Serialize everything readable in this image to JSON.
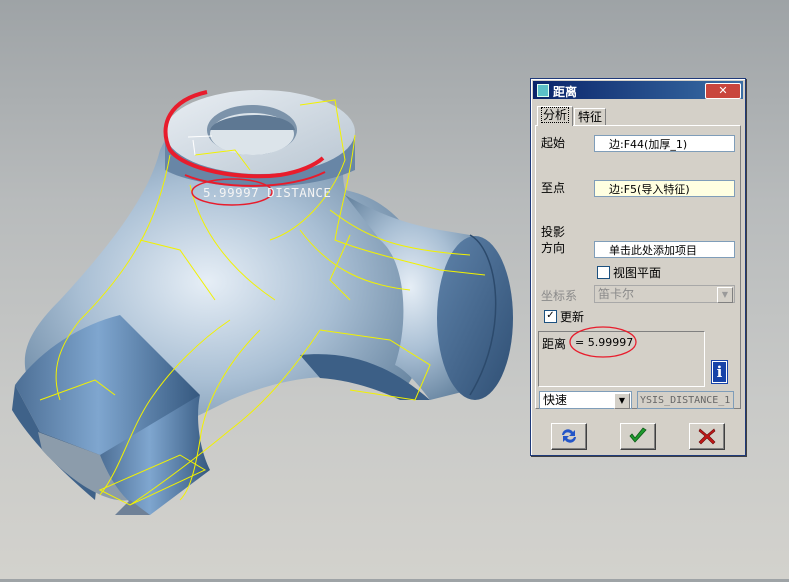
{
  "viewport": {
    "measurement_label": "5.99997 DISTANCE"
  },
  "dialog": {
    "title": "距离",
    "close_label": "✕",
    "tabs": [
      {
        "label": "分析",
        "active": true
      },
      {
        "label": "特征",
        "active": false
      }
    ],
    "from": {
      "label": "起始",
      "value": "边:F44(加厚_1)"
    },
    "to": {
      "label": "至点",
      "value": "边:F5(导入特征)"
    },
    "projection": {
      "label_line1": "投影",
      "label_line2": "方向",
      "value": "单击此处添加项目"
    },
    "view_plane": {
      "label": "视图平面",
      "checked": false
    },
    "coord_system": {
      "label": "坐标系",
      "value": "笛卡尔",
      "disabled": true
    },
    "update": {
      "label": "更新",
      "checked": true
    },
    "result": {
      "label": "距离",
      "value": "= 5.99997"
    },
    "mode_select": {
      "value": "快速"
    },
    "feature_name": {
      "value": "YSIS_DISTANCE_1"
    },
    "buttons": {
      "repaint": "repaint-icon",
      "ok": "checkmark-icon",
      "cancel": "cross-icon"
    },
    "colors": {
      "title_bar": "#0a246a",
      "ok_green": "#1f9a2e",
      "cancel_red": "#c01818",
      "highlight_red": "#e81c2c"
    }
  }
}
